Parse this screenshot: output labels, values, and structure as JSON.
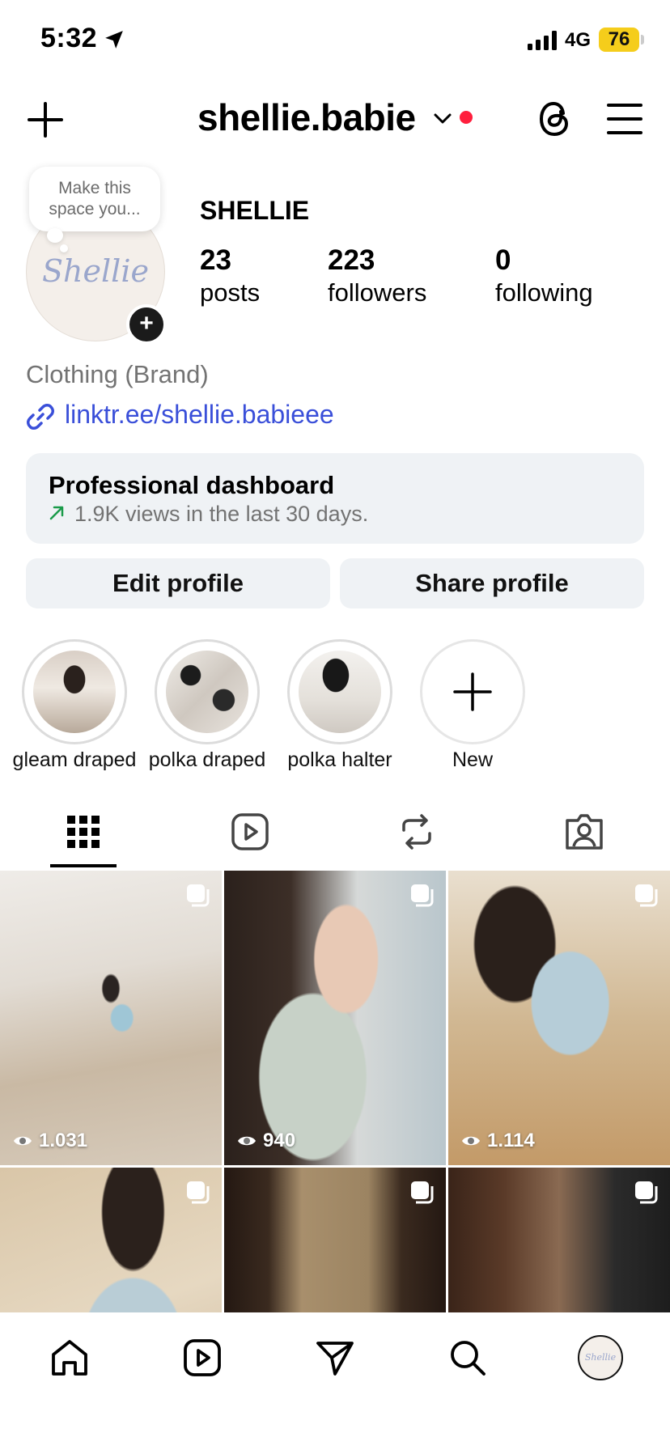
{
  "status": {
    "time": "5:32",
    "network": "4G",
    "battery": "76"
  },
  "header": {
    "username": "shellie.babie"
  },
  "profile": {
    "avatar_text": "Shellie",
    "tooltip_line1": "Make this",
    "tooltip_line2": "space you...",
    "display_name": "SHELLIE",
    "stats": [
      {
        "num": "23",
        "label": "posts"
      },
      {
        "num": "223",
        "label": "followers"
      },
      {
        "num": "0",
        "label": "following"
      }
    ],
    "category": "Clothing (Brand)",
    "link": "linktr.ee/shellie.babieee"
  },
  "dashboard": {
    "title": "Professional dashboard",
    "subtitle": "1.9K views in the last 30 days."
  },
  "buttons": {
    "edit": "Edit profile",
    "share": "Share profile"
  },
  "highlights": [
    {
      "label": "gleam draped"
    },
    {
      "label": "polka draped"
    },
    {
      "label": "polka halter"
    },
    {
      "label": "New"
    }
  ],
  "tabs": [
    "grid-icon",
    "reels-icon",
    "reposts-icon",
    "tagged-icon"
  ],
  "grid": [
    {
      "views": "1.031"
    },
    {
      "views": "940"
    },
    {
      "views": "1.114"
    },
    {
      "views": ""
    },
    {
      "views": ""
    },
    {
      "views": ""
    }
  ],
  "nav": [
    "home-icon",
    "reels-icon",
    "send-icon",
    "search-icon",
    "profile-avatar"
  ],
  "colors": {
    "link": "#3a4fd9",
    "battery": "#f5cd1b",
    "notification": "#ff1f3d"
  }
}
